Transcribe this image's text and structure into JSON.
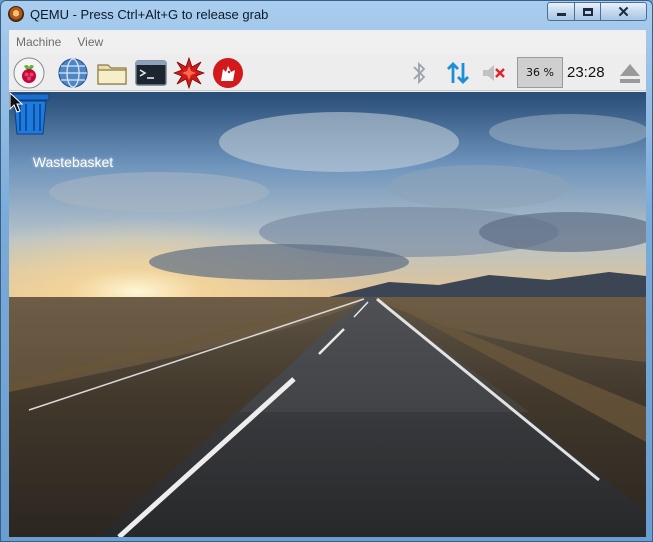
{
  "window": {
    "title": "QEMU - Press Ctrl+Alt+G to release grab",
    "controls": [
      "minimize",
      "maximize",
      "close"
    ]
  },
  "menubar": {
    "items": [
      "Machine",
      "View"
    ]
  },
  "panel": {
    "launchers": [
      {
        "name": "raspberry-menu-icon"
      },
      {
        "name": "web-browser-icon"
      },
      {
        "name": "file-manager-icon"
      },
      {
        "name": "terminal-icon"
      },
      {
        "name": "mathematica-icon"
      },
      {
        "name": "wolfram-icon"
      }
    ],
    "tray": {
      "bluetooth_icon": "bluetooth-icon",
      "network_icon": "network-updown-icon",
      "volume_icon": "volume-muted-icon",
      "cpu_usage": "36 %",
      "clock": "23:28",
      "eject_icon": "eject-icon"
    }
  },
  "desktop": {
    "icons": [
      {
        "label": "Wastebasket",
        "icon": "trash-icon"
      }
    ],
    "wallpaper": "road-at-sunset"
  },
  "colors": {
    "titlebar": "#7aabd9",
    "panel_bg": "#ededed",
    "net_icon": "#1d8ed8",
    "trash_blue": "#1a6fd1"
  }
}
